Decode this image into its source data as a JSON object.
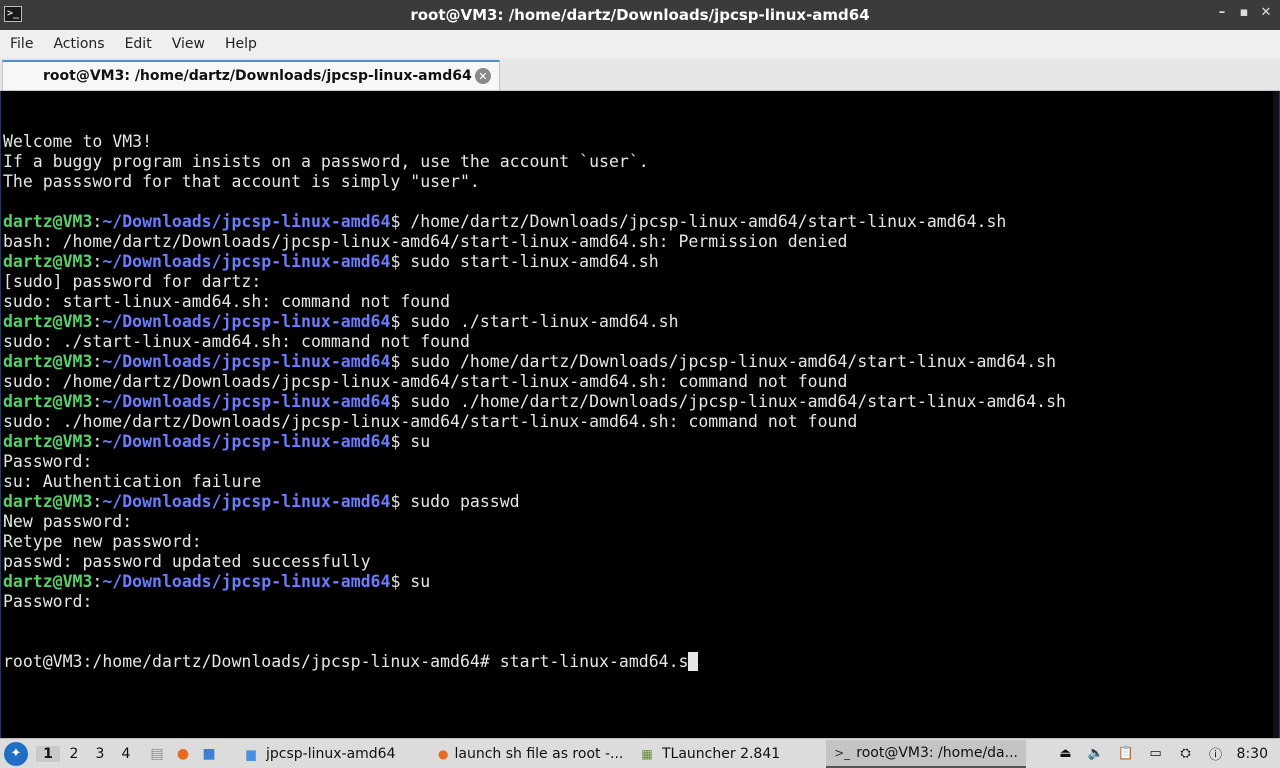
{
  "window": {
    "title": "root@VM3: /home/dartz/Downloads/jpcsp-linux-amd64",
    "controls": [
      "–",
      "▪",
      "✕"
    ]
  },
  "menu": [
    "File",
    "Actions",
    "Edit",
    "View",
    "Help"
  ],
  "tab": {
    "label": "root@VM3: /home/dartz/Downloads/jpcsp-linux-amd64",
    "close": "✕"
  },
  "terminal": {
    "prompt_user": "dartz@VM3",
    "prompt_path": "~/Downloads/jpcsp-linux-amd64",
    "lines": [
      {
        "text": "Welcome to VM3!"
      },
      {
        "text": "If a buggy program insists on a password, use the account `user`."
      },
      {
        "text": "The passsword for that account is simply \"user\"."
      },
      {
        "text": ""
      },
      {
        "cmd": " /home/dartz/Downloads/jpcsp-linux-amd64/start-linux-amd64.sh"
      },
      {
        "text": "bash: /home/dartz/Downloads/jpcsp-linux-amd64/start-linux-amd64.sh: Permission denied"
      },
      {
        "cmd": " sudo start-linux-amd64.sh"
      },
      {
        "text": "[sudo] password for dartz:"
      },
      {
        "text": "sudo: start-linux-amd64.sh: command not found"
      },
      {
        "cmd": " sudo ./start-linux-amd64.sh"
      },
      {
        "text": "sudo: ./start-linux-amd64.sh: command not found"
      },
      {
        "cmd": " sudo /home/dartz/Downloads/jpcsp-linux-amd64/start-linux-amd64.sh"
      },
      {
        "text": "sudo: /home/dartz/Downloads/jpcsp-linux-amd64/start-linux-amd64.sh: command not found"
      },
      {
        "cmd": " sudo ./home/dartz/Downloads/jpcsp-linux-amd64/start-linux-amd64.sh"
      },
      {
        "text": "sudo: ./home/dartz/Downloads/jpcsp-linux-amd64/start-linux-amd64.sh: command not found"
      },
      {
        "cmd": " su"
      },
      {
        "text": "Password:"
      },
      {
        "text": "su: Authentication failure"
      },
      {
        "cmd": " sudo passwd"
      },
      {
        "text": "New password:"
      },
      {
        "text": "Retype new password:"
      },
      {
        "text": "passwd: password updated successfully"
      },
      {
        "cmd": " su"
      },
      {
        "text": "Password:"
      }
    ],
    "root_prompt": "root@VM3:/home/dartz/Downloads/jpcsp-linux-amd64# ",
    "current_input": "start-linux-amd64.s"
  },
  "taskbar": {
    "start_icon": "lxqt-start-icon",
    "desktops": [
      "1",
      "2",
      "3",
      "4"
    ],
    "active_desktop": "1",
    "launchers": [
      {
        "icon": "archive-manager-icon",
        "glyph": "▤",
        "color": "#8d8d8d"
      },
      {
        "icon": "firefox-icon",
        "glyph": "●",
        "color": "#e66a1f"
      },
      {
        "icon": "file-manager-icon",
        "glyph": "■",
        "color": "#3f7fd6"
      }
    ],
    "tasks": [
      {
        "label": "jpcsp-linux-amd64",
        "icon": "folder-icon",
        "glyph": "▆",
        "color": "#4a8fe0",
        "width": 196
      },
      {
        "label": "launch sh file as root -...",
        "icon": "firefox-icon",
        "glyph": "●",
        "color": "#e66a1f",
        "width": 200
      },
      {
        "label": "TLauncher 2.841",
        "icon": "minecraft-block-icon",
        "glyph": "▦",
        "color": "#5f8a3a",
        "width": 196
      },
      {
        "label": "root@VM3: /home/da...",
        "icon": "terminal-icon",
        "glyph": ">_",
        "color": "#333333",
        "width": 200
      }
    ],
    "active_task": 3,
    "tray": [
      {
        "icon": "eject-icon",
        "glyph": "⏏"
      },
      {
        "icon": "volume-icon",
        "glyph": "🔈"
      },
      {
        "icon": "clipboard-icon",
        "glyph": "📋"
      },
      {
        "icon": "display-icon",
        "glyph": "▭"
      },
      {
        "icon": "network-icon",
        "glyph": "⛭"
      },
      {
        "icon": "notification-icon",
        "glyph": "ⓘ"
      }
    ],
    "clock": "8:30"
  }
}
